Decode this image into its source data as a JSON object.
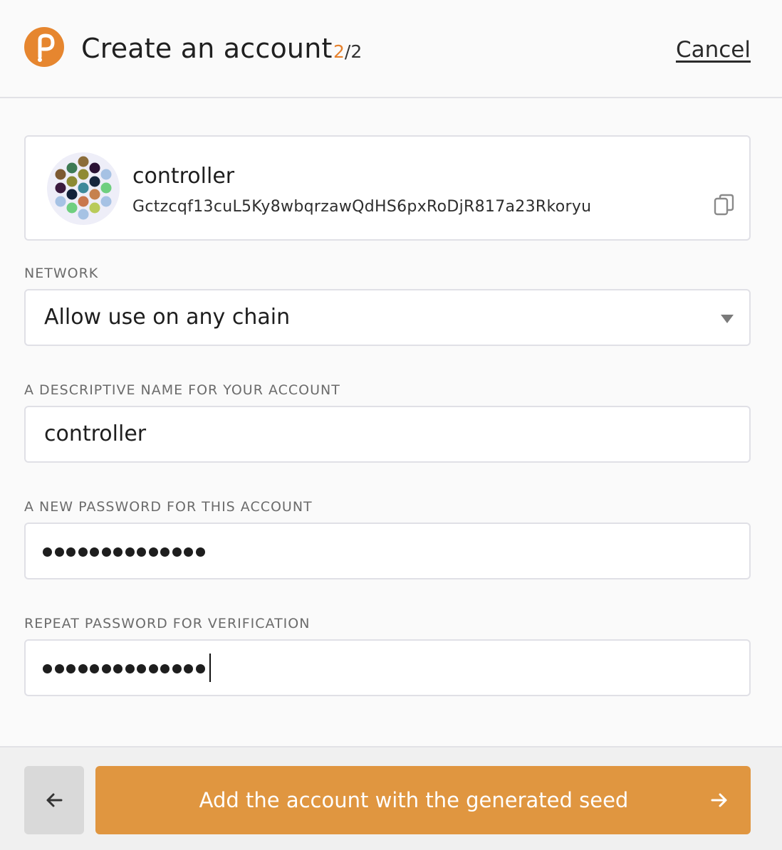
{
  "header": {
    "title": "Create an account",
    "step_current": "2",
    "step_total": "/2",
    "cancel_label": "Cancel",
    "logo_icon": "polkadot-logo-icon"
  },
  "account": {
    "name": "controller",
    "address": "Gctzcqf13cuL5Ky8wbqrzawQdHS6pxRoDjR817a23Rkoryu",
    "identicon_icon": "identicon",
    "copy_icon": "copy-icon"
  },
  "network": {
    "label": "NETWORK",
    "selected": "Allow use on any chain"
  },
  "name_field": {
    "label": "A DESCRIPTIVE NAME FOR YOUR ACCOUNT",
    "value": "controller"
  },
  "password_field": {
    "label": "A NEW PASSWORD FOR THIS ACCOUNT",
    "masked_length": 14
  },
  "repeat_password_field": {
    "label": "REPEAT PASSWORD FOR VERIFICATION",
    "masked_length": 14
  },
  "footer": {
    "back_icon": "arrow-left-icon",
    "submit_label": "Add the account with the generated seed",
    "submit_icon": "arrow-right-icon"
  },
  "colors": {
    "accent": "#e6822e",
    "button": "#e09640",
    "logo": "#e6862f"
  }
}
